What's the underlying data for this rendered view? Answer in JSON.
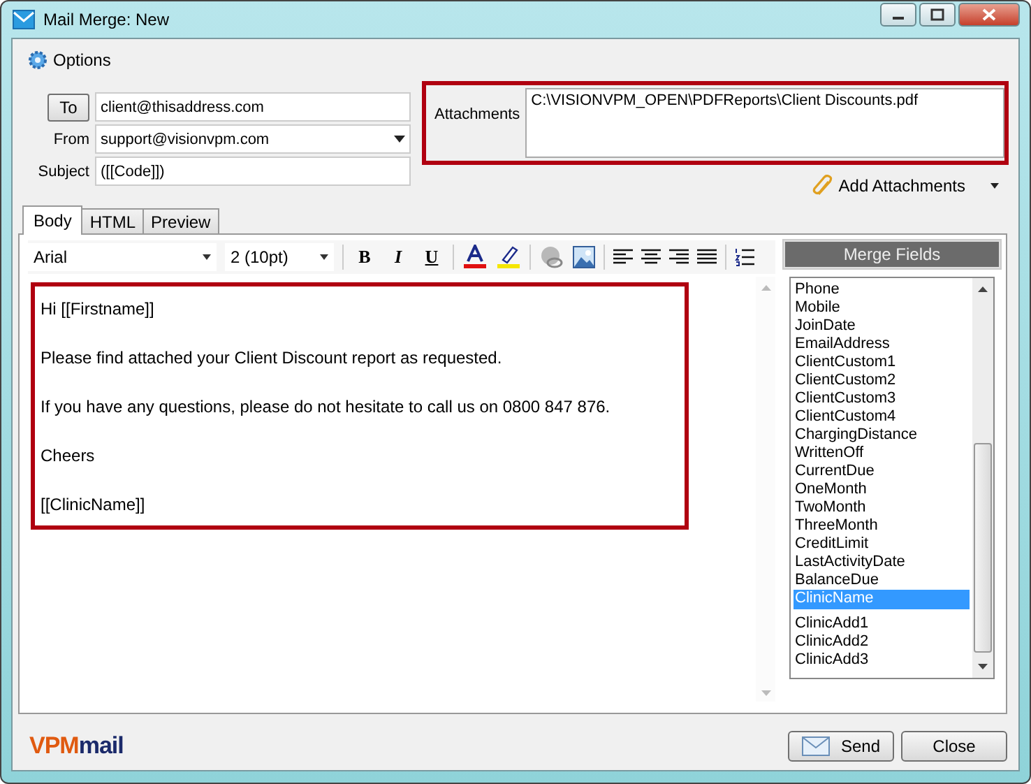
{
  "window": {
    "title": "Mail Merge: New"
  },
  "options": {
    "label": "Options"
  },
  "to": {
    "button": "To",
    "value": "client@thisaddress.com"
  },
  "from": {
    "label": "From",
    "value": "support@visionvpm.com"
  },
  "subject": {
    "label": "Subject",
    "value": "([[Code]])"
  },
  "attachments": {
    "label": "Attachments",
    "value": "C:\\VISIONVPM_OPEN\\PDFReports\\Client Discounts.pdf",
    "add_label": "Add Attachments"
  },
  "tabs": [
    {
      "label": "Body",
      "selected": true
    },
    {
      "label": "HTML",
      "selected": false
    },
    {
      "label": "Preview",
      "selected": false
    }
  ],
  "toolbar": {
    "font": "Arial",
    "size": "2 (10pt)",
    "bold": "B",
    "italic": "I",
    "underline": "U"
  },
  "body": [
    "Hi [[Firstname]]",
    "Please find attached your Client Discount report as requested.",
    "If you have any questions, please do not hesitate to call us on 0800 847 876.",
    "Cheers",
    "[[ClinicName]]"
  ],
  "merge_fields": {
    "title": "Merge Fields",
    "items": [
      {
        "label": "Phone",
        "selected": false
      },
      {
        "label": "Mobile",
        "selected": false
      },
      {
        "label": "JoinDate",
        "selected": false
      },
      {
        "label": "EmailAddress",
        "selected": false
      },
      {
        "label": "ClientCustom1",
        "selected": false
      },
      {
        "label": "ClientCustom2",
        "selected": false
      },
      {
        "label": "ClientCustom3",
        "selected": false
      },
      {
        "label": "ClientCustom4",
        "selected": false
      },
      {
        "label": "ChargingDistance",
        "selected": false
      },
      {
        "label": "WrittenOff",
        "selected": false
      },
      {
        "label": "CurrentDue",
        "selected": false
      },
      {
        "label": "OneMonth",
        "selected": false
      },
      {
        "label": "TwoMonth",
        "selected": false
      },
      {
        "label": "ThreeMonth",
        "selected": false
      },
      {
        "label": "CreditLimit",
        "selected": false
      },
      {
        "label": "LastActivityDate",
        "selected": false
      },
      {
        "label": "BalanceDue",
        "selected": false
      },
      {
        "label": "ClinicName",
        "selected": true
      },
      {
        "label": "ClinicAdd1",
        "selected": false
      },
      {
        "label": "ClinicAdd2",
        "selected": false
      },
      {
        "label": "ClinicAdd3",
        "selected": false
      }
    ]
  },
  "logo": {
    "brand": "VPM",
    "product": "mail"
  },
  "buttons": {
    "send": "Send",
    "close": "Close"
  }
}
